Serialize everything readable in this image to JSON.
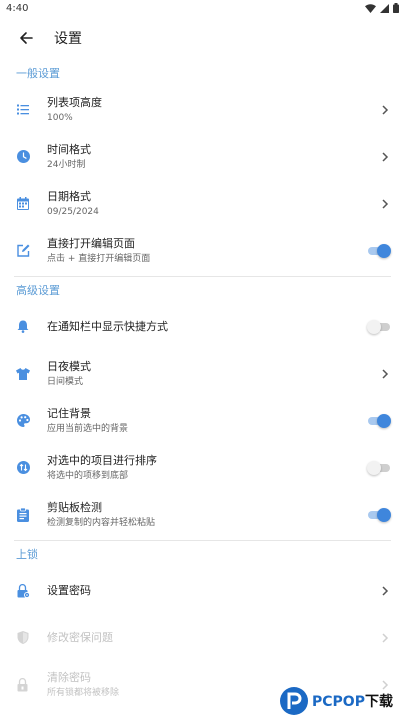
{
  "status_bar": {
    "time": "4:40"
  },
  "app_bar": {
    "title": "设置"
  },
  "sections": {
    "general": {
      "header": "一般设置",
      "list_height": {
        "title": "列表项高度",
        "sub": "100%"
      },
      "time_format": {
        "title": "时间格式",
        "sub": "24小时制"
      },
      "date_format": {
        "title": "日期格式",
        "sub": "09/25/2024"
      },
      "open_edit": {
        "title": "直接打开编辑页面",
        "sub": "点击 + 直接打开编辑页面",
        "enabled": true
      }
    },
    "advanced": {
      "header": "高级设置",
      "notify_shortcut": {
        "title": "在通知栏中显示快捷方式",
        "enabled": false
      },
      "day_night": {
        "title": "日夜模式",
        "sub": "日间模式"
      },
      "remember_bg": {
        "title": "记住背景",
        "sub": "应用当前选中的背景",
        "enabled": true
      },
      "sort_selected": {
        "title": "对选中的项目进行排序",
        "sub": "将选中的项移到底部",
        "enabled": false
      },
      "clipboard": {
        "title": "剪贴板检测",
        "sub": "检测复制的内容并轻松粘贴",
        "enabled": true
      }
    },
    "lock": {
      "header": "上锁",
      "set_password": {
        "title": "设置密码"
      },
      "change_security": {
        "title": "修改密保问题"
      },
      "clear_password": {
        "title": "清除密码",
        "sub": "所有锁都将被移除"
      }
    }
  },
  "watermark": {
    "brand": "PCPOP",
    "suffix": "下载"
  },
  "colors": {
    "accent": "#5b9bd5",
    "toggle_on": "#3f86dc",
    "icon_blue": "#4a8fe0"
  }
}
